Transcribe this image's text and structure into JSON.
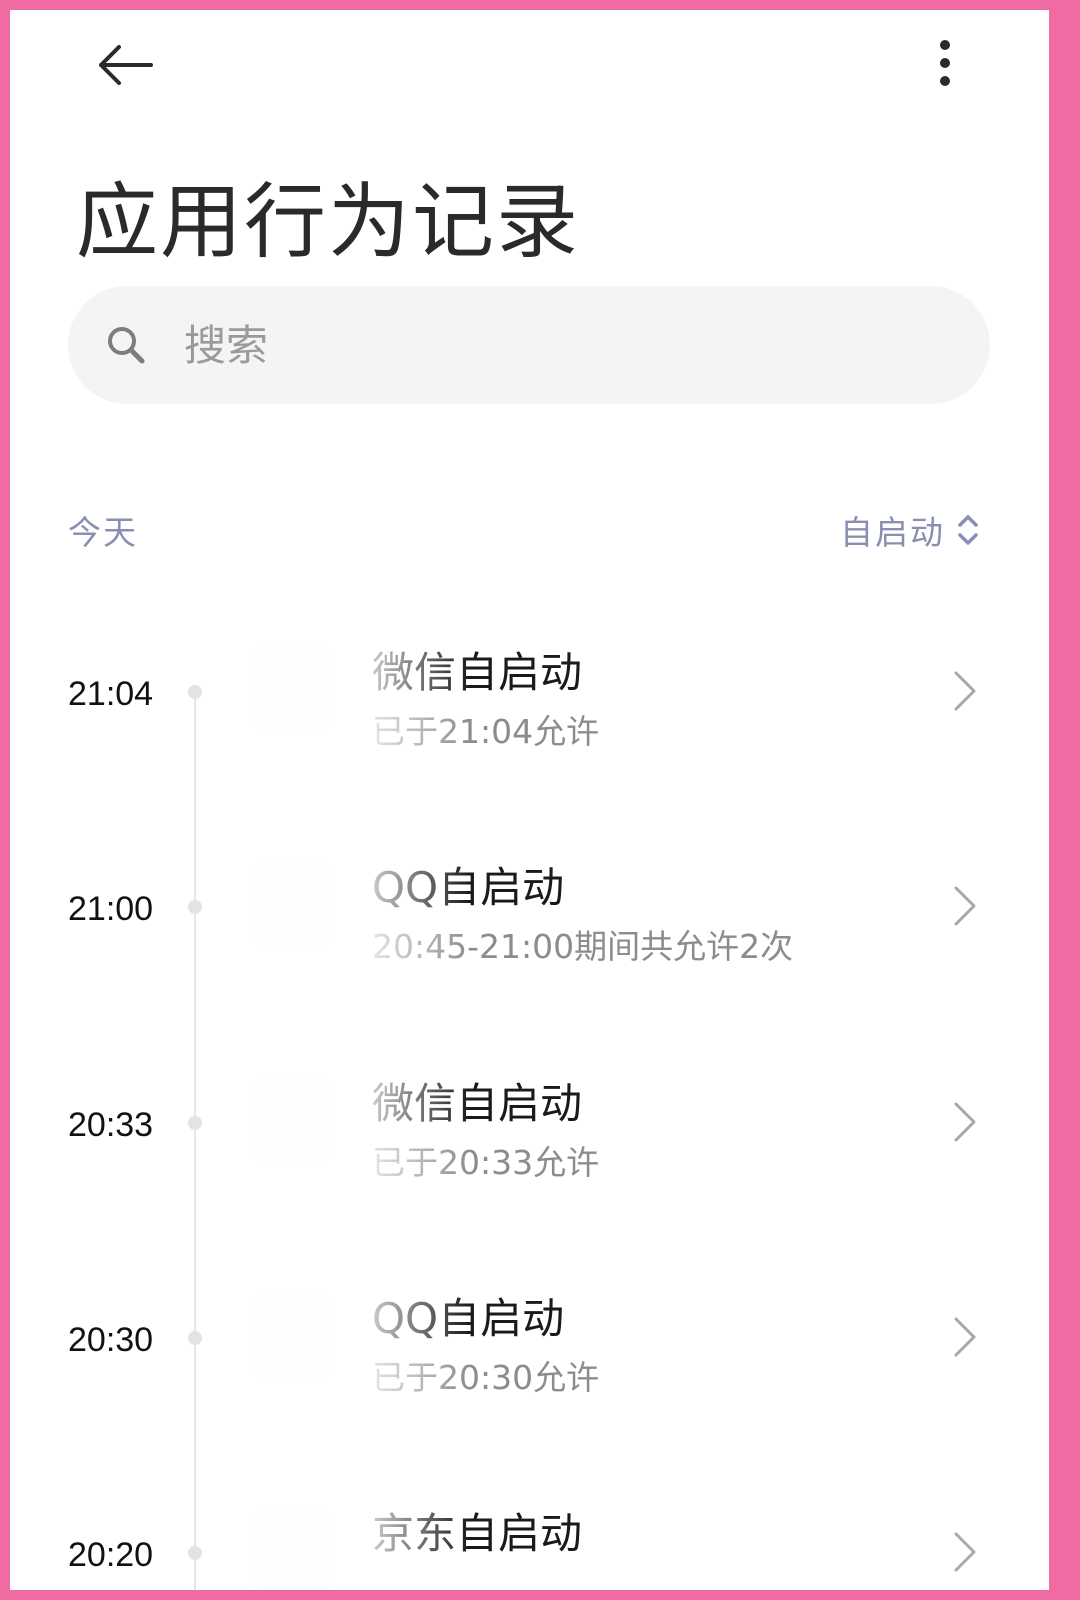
{
  "header": {
    "back_icon": "back-arrow-icon",
    "more_icon": "more-vertical-icon",
    "title": "应用行为记录"
  },
  "search": {
    "icon": "search-icon",
    "placeholder": "搜索",
    "value": ""
  },
  "section": {
    "label": "今天",
    "filter_label": "自启动",
    "filter_icon": "sort-updown-icon"
  },
  "records": [
    {
      "time": "21:04",
      "title": "微信自启动",
      "subtitle": "已于21:04允许"
    },
    {
      "time": "21:00",
      "title": "QQ自启动",
      "subtitle": "20:45-21:00期间共允许2次"
    },
    {
      "time": "20:33",
      "title": "微信自启动",
      "subtitle": "已于20:33允许"
    },
    {
      "time": "20:30",
      "title": "QQ自启动",
      "subtitle": "已于20:30允许"
    },
    {
      "time": "20:20",
      "title": "京东自启动",
      "subtitle": ""
    }
  ],
  "colors": {
    "accent_label": "#8a8fb2",
    "frame": "#f06aa3"
  }
}
